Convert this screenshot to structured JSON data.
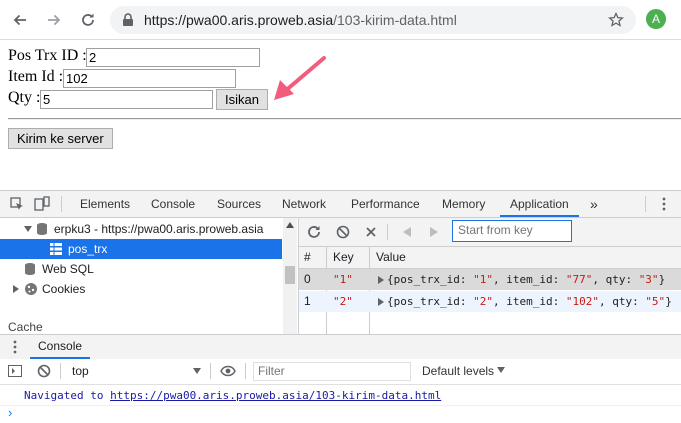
{
  "browser": {
    "url_host": "https://pwa00.aris.proweb.asia",
    "url_path": "/103-kirim-data.html",
    "avatar_letter": "A",
    "avatar_color": "#4caf50"
  },
  "page": {
    "fields": [
      {
        "label": "Pos Trx ID :",
        "value": "2"
      },
      {
        "label": "Item Id :",
        "value": "102"
      },
      {
        "label": "Qty :",
        "value": "5"
      }
    ],
    "isikan_label": "Isikan",
    "send_label": "Kirim ke server",
    "arrow_color": "#f25d7d"
  },
  "devtools": {
    "tabs": [
      "Elements",
      "Console",
      "Sources",
      "Network",
      "Performance",
      "Memory",
      "Application"
    ],
    "active_tab": "Application",
    "more_tabs": "»",
    "sidebar": {
      "db_label": "erpku3 - https://pwa00.aris.proweb.asia",
      "store_label": "pos_trx",
      "websql_label": "Web SQL",
      "cookies_label": "Cookies",
      "cache_label": "Cache"
    },
    "grid": {
      "filter_placeholder": "Start from key",
      "headers": [
        "#",
        "Key",
        "Value"
      ],
      "rows": [
        {
          "index": "0",
          "key": "\"1\"",
          "v_id": "\"1\"",
          "v_item": "\"77\"",
          "v_qty": "\"3\""
        },
        {
          "index": "1",
          "key": "\"2\"",
          "v_id": "\"2\"",
          "v_item": "\"102\"",
          "v_qty": "\"5\""
        }
      ],
      "obj_open": "{pos_trx_id: ",
      "obj_item": ", item_id: ",
      "obj_qty": ", qty: ",
      "obj_close": "}"
    },
    "console": {
      "tab_label": "Console",
      "context": "top",
      "filter_placeholder": "Filter",
      "levels_label": "Default levels",
      "navigated_text": "Navigated to ",
      "navigated_url": "https://pwa00.aris.proweb.asia/103-kirim-data.html",
      "prompt": "›"
    }
  }
}
